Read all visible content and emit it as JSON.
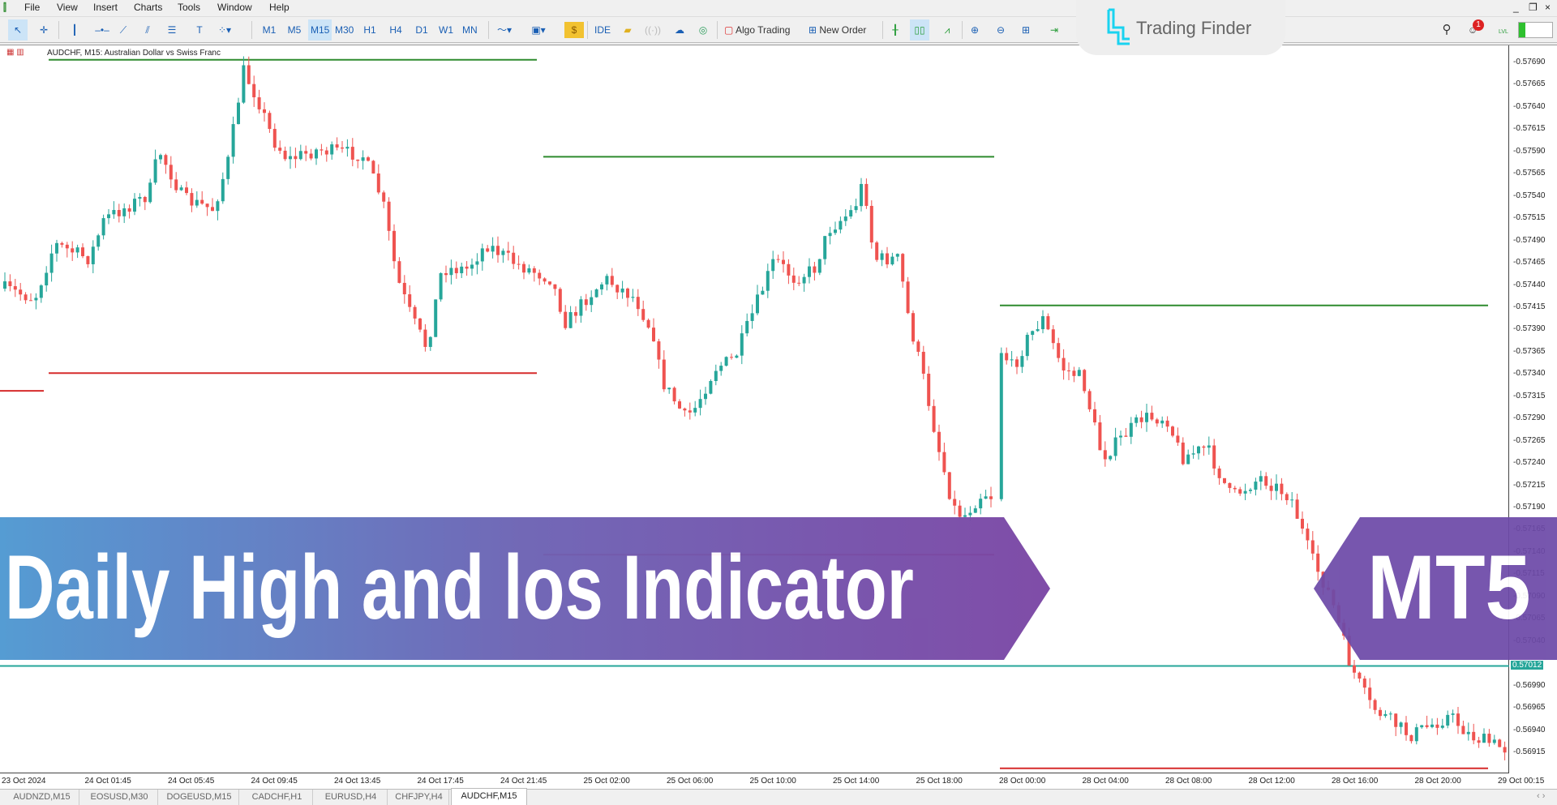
{
  "menu": [
    "File",
    "View",
    "Insert",
    "Charts",
    "Tools",
    "Window",
    "Help"
  ],
  "toolbar": {
    "timeframes": [
      "M1",
      "M5",
      "M15",
      "M30",
      "H1",
      "H4",
      "D1",
      "W1",
      "MN"
    ],
    "selected_timeframe": "M15",
    "ide": "IDE",
    "algo_trading": "Algo Trading",
    "new_order": "New Order"
  },
  "logo": {
    "text": "Trading Finder"
  },
  "notifications": {
    "count": "1"
  },
  "level": "LVL",
  "chart": {
    "title": "AUDCHF, M15:  Australian Dollar vs Swiss Franc",
    "price_labels": [
      "0.57690",
      "0.57665",
      "0.57640",
      "0.57615",
      "0.57590",
      "0.57565",
      "0.57540",
      "0.57515",
      "0.57490",
      "0.57465",
      "0.57440",
      "0.57415",
      "0.57390",
      "0.57365",
      "0.57340",
      "0.57315",
      "0.57290",
      "0.57265",
      "0.57240",
      "0.57215",
      "0.57190",
      "0.57165",
      "0.57140",
      "0.57115",
      "0.57090",
      "0.57065",
      "0.57040",
      "0.56990",
      "0.56965",
      "0.56940",
      "0.56915"
    ],
    "current_price": "0.57012",
    "time_labels": [
      "23 Oct 2024",
      "24 Oct 01:45",
      "24 Oct 05:45",
      "24 Oct 09:45",
      "24 Oct 13:45",
      "24 Oct 17:45",
      "24 Oct 21:45",
      "25 Oct 02:00",
      "25 Oct 06:00",
      "25 Oct 10:00",
      "25 Oct 14:00",
      "25 Oct 18:00",
      "28 Oct 00:00",
      "28 Oct 04:00",
      "28 Oct 08:00",
      "28 Oct 12:00",
      "28 Oct 16:00",
      "28 Oct 20:00",
      "29 Oct 00:15"
    ],
    "daily_levels": [
      {
        "day": "23 Oct",
        "low": 0.57321
      },
      {
        "day": "24 Oct",
        "high": 0.57693,
        "low": 0.57341
      },
      {
        "day": "25 Oct",
        "high": 0.57584,
        "low": 0.57137
      },
      {
        "day": "28 Oct",
        "high": 0.57417,
        "low": 0.56897
      }
    ],
    "colors": {
      "high": "#2e8b2e",
      "low": "#d62b2b",
      "bull": "#26a69a",
      "bear": "#ef5350",
      "current": "#26a69a"
    }
  },
  "tabs": [
    "AUDNZD,M15",
    "EOSUSD,M30",
    "DOGEUSD,M15",
    "CADCHF,H1",
    "EURUSD,H4",
    "CHFJPY,H4",
    "AUDCHF,M15"
  ],
  "active_tab": "AUDCHF,M15",
  "banner": {
    "title": "Daily High and los Indicator",
    "badge": "MT5"
  }
}
